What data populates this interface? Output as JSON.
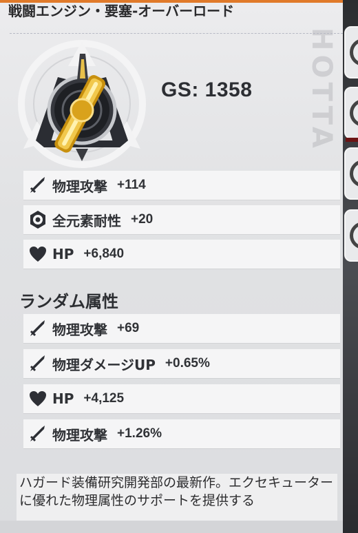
{
  "item": {
    "title": "戦闘エンジン・要塞-オーバーロード",
    "gs": "GS: 1358",
    "watermark": "HOTTA"
  },
  "base_stats": [
    {
      "icon": "sword-icon",
      "name": "物理攻撃",
      "value": "+114"
    },
    {
      "icon": "element-resist-icon",
      "name": "全元素耐性",
      "value": "+20"
    },
    {
      "icon": "heart-icon",
      "name": "HP",
      "value": "+6,840"
    }
  ],
  "random": {
    "heading": "ランダム属性",
    "stats": [
      {
        "icon": "sword-icon",
        "name": "物理攻撃",
        "value": "+69"
      },
      {
        "icon": "sword-icon",
        "name": "物理ダメージUP",
        "value": "+0.65%"
      },
      {
        "icon": "heart-icon",
        "name": "HP",
        "value": "+4,125"
      },
      {
        "icon": "sword-icon",
        "name": "物理攻撃",
        "value": "+1.26%"
      }
    ]
  },
  "description": "ハガード装備研究開発部の最新作。エクセキューターに優れた物理属性のサポートを提供する",
  "colors": {
    "accent": "#e07a2a",
    "gold": "#d9a21c",
    "text": "#303236",
    "panel": "#e6e7e9"
  }
}
